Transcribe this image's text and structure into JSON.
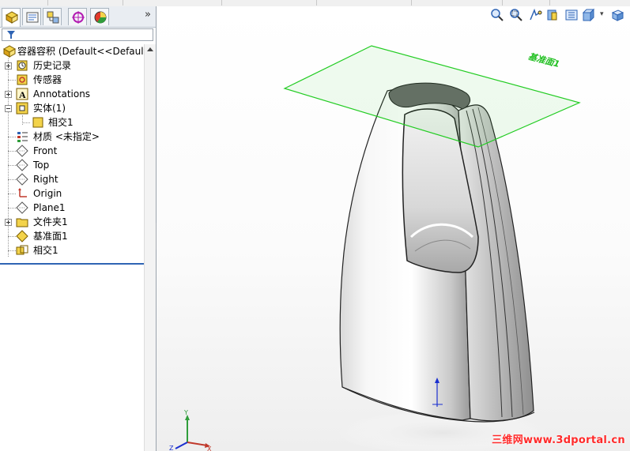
{
  "colors": {
    "selection_line": "#2f64b4",
    "plane_green": "#22cc22",
    "watermark_red": "#ff2a2a",
    "folder_yellow": "#f3d34a"
  },
  "panel": {
    "tabs": [
      {
        "name": "FeatureManager",
        "icon": "feature-tree-icon",
        "active": true
      },
      {
        "name": "PropertyManager",
        "icon": "property-manager-icon",
        "active": false
      },
      {
        "name": "ConfigurationManager",
        "icon": "configuration-manager-icon",
        "active": false
      },
      {
        "name": "DimXpertManager",
        "icon": "dimxpert-icon",
        "active": false
      },
      {
        "name": "DisplayManager",
        "icon": "display-manager-icon",
        "active": false
      }
    ],
    "expand_chevron": "»",
    "filter_icon": "filter-icon",
    "tree": [
      {
        "label": "容器容积  (Default<<Default",
        "icon": "part-icon",
        "expander": "none",
        "indent": 0
      },
      {
        "label": "历史记录",
        "icon": "history-icon",
        "expander": "plus",
        "indent": 1
      },
      {
        "label": "传感器",
        "icon": "sensor-icon",
        "expander": "none",
        "indent": 1
      },
      {
        "label": "Annotations",
        "icon": "annotations-icon",
        "expander": "plus",
        "indent": 1
      },
      {
        "label": "实体(1)",
        "icon": "solid-bodies-icon",
        "expander": "minus",
        "indent": 1
      },
      {
        "label": "相交1",
        "icon": "body-icon",
        "expander": "none",
        "indent": 2
      },
      {
        "label": "材质 <未指定>",
        "icon": "material-icon",
        "expander": "none",
        "indent": 1
      },
      {
        "label": "Front",
        "icon": "plane-icon",
        "expander": "none",
        "indent": 1
      },
      {
        "label": "Top",
        "icon": "plane-icon",
        "expander": "none",
        "indent": 1
      },
      {
        "label": "Right",
        "icon": "plane-icon",
        "expander": "none",
        "indent": 1
      },
      {
        "label": "Origin",
        "icon": "origin-icon",
        "expander": "none",
        "indent": 1
      },
      {
        "label": "Plane1",
        "icon": "plane-icon",
        "expander": "none",
        "indent": 1
      },
      {
        "label": "文件夹1",
        "icon": "folder-icon",
        "expander": "plus",
        "indent": 1
      },
      {
        "label": "基准面1",
        "icon": "reference-plane-icon",
        "expander": "none",
        "indent": 1
      },
      {
        "label": "相交1",
        "icon": "intersect-feature-icon",
        "expander": "none",
        "indent": 1
      }
    ]
  },
  "viewport": {
    "view_tools": [
      "zoom-to-fit-icon",
      "zoom-to-area-icon",
      "previous-view-icon",
      "section-view-icon",
      "view-orientation-icon",
      "display-style-icon"
    ],
    "plane_label": "基准面1",
    "triad": {
      "x": "X",
      "y": "Y",
      "z": "Z"
    },
    "watermark": "三维网www.3dportal.cn"
  }
}
